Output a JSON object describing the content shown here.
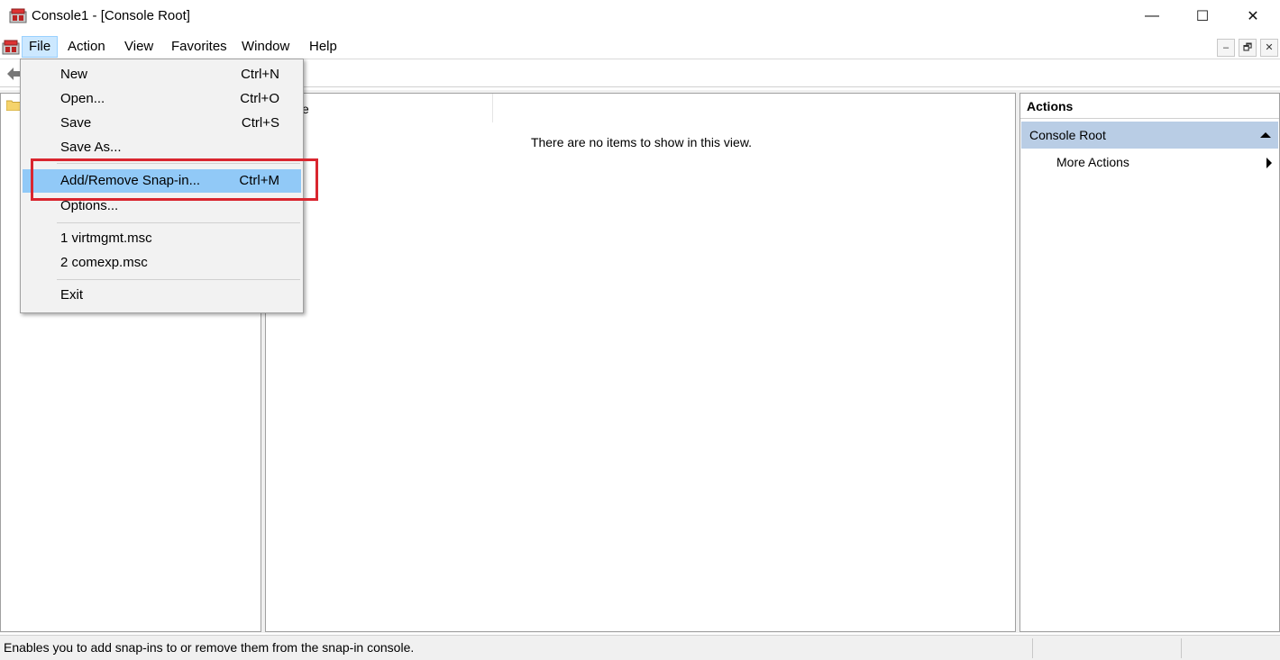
{
  "window": {
    "title": "Console1 - [Console Root]",
    "minimize_glyph": "—",
    "maximize_glyph": "☐",
    "close_glyph": "✕"
  },
  "menubar": {
    "items": [
      "File",
      "Action",
      "View",
      "Favorites",
      "Window",
      "Help"
    ],
    "active": "File",
    "mdi_buttons": [
      "–",
      "🗗",
      "✕"
    ]
  },
  "file_menu": {
    "items": [
      {
        "label": "New",
        "shortcut": "Ctrl+N"
      },
      {
        "label": "Open...",
        "shortcut": "Ctrl+O"
      },
      {
        "label": "Save",
        "shortcut": "Ctrl+S"
      },
      {
        "label": "Save As...",
        "shortcut": ""
      },
      {
        "label": "Add/Remove Snap-in...",
        "shortcut": "Ctrl+M"
      },
      {
        "label": "Options...",
        "shortcut": ""
      },
      {
        "label": "1 virtmgmt.msc",
        "shortcut": ""
      },
      {
        "label": "2 comexp.msc",
        "shortcut": ""
      },
      {
        "label": "Exit",
        "shortcut": ""
      }
    ],
    "highlighted": "Add/Remove Snap-in..."
  },
  "result_pane": {
    "column_header": "e",
    "empty_message": "There are no items to show in this view."
  },
  "actions_pane": {
    "title": "Actions",
    "group": "Console Root",
    "more_actions": "More Actions"
  },
  "statusbar": {
    "text": "Enables you to add snap-ins to or remove them from the snap-in console."
  },
  "colors": {
    "highlight": "#91c9f7",
    "annotation": "#d9262f",
    "actions_group": "#b9cde5"
  }
}
